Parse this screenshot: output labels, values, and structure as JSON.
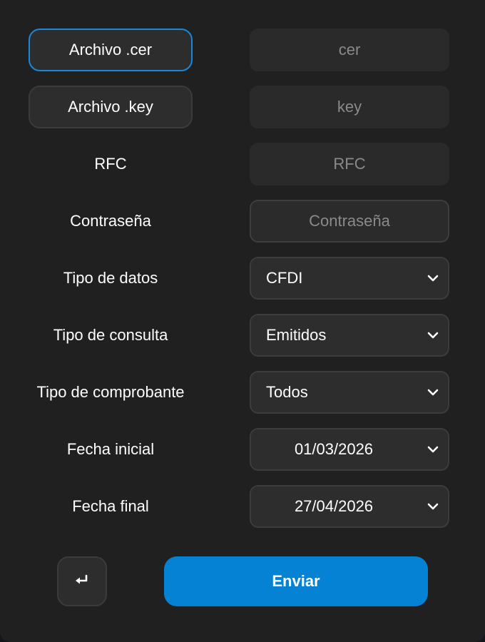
{
  "colors": {
    "background": "#202020",
    "accent": "#0582d4",
    "focus_border": "#1a87d8",
    "placeholder": "#8a8a8a"
  },
  "form": {
    "cer_button": "Archivo .cer",
    "cer_placeholder": "cer",
    "key_button": "Archivo .key",
    "key_placeholder": "key",
    "rfc_label": "RFC",
    "rfc_placeholder": "RFC",
    "password_label": "Contraseña",
    "password_placeholder": "Contraseña",
    "data_type_label": "Tipo de datos",
    "data_type_value": "CFDI",
    "query_type_label": "Tipo de consulta",
    "query_type_value": "Emitidos",
    "voucher_type_label": "Tipo de comprobante",
    "voucher_type_value": "Todos",
    "start_date_label": "Fecha inicial",
    "start_date_value": "01/03/2026",
    "end_date_label": "Fecha final",
    "end_date_value": "27/04/2026"
  },
  "actions": {
    "back_icon": "return-arrow-icon",
    "send_label": "Enviar"
  }
}
